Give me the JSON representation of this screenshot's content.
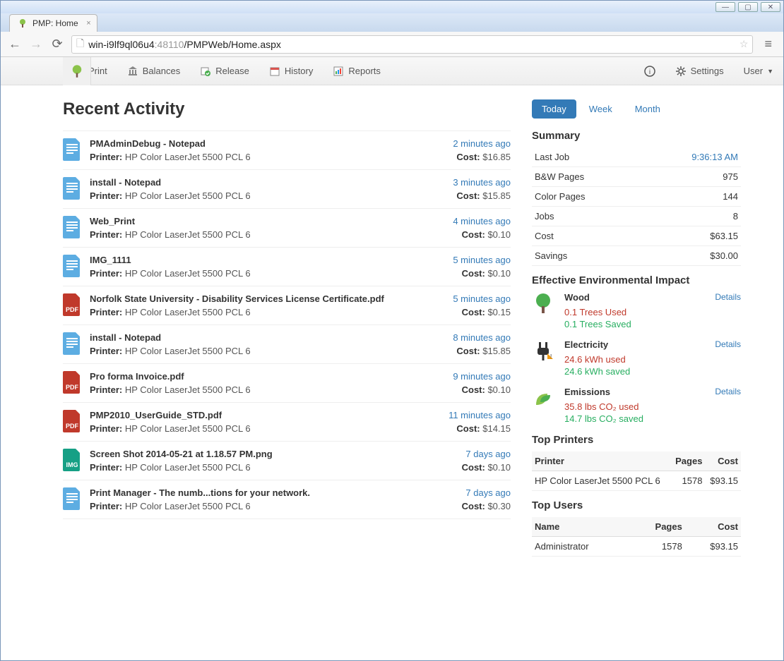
{
  "window": {
    "tab_title": "PMP: Home",
    "url_host": "win-i9lf9ql06u4",
    "url_port": ":48110",
    "url_path": "/PMPWeb/Home.aspx"
  },
  "nav": {
    "print": "Print",
    "balances": "Balances",
    "release": "Release",
    "history": "History",
    "reports": "Reports",
    "settings": "Settings",
    "user": "User"
  },
  "page_title": "Recent Activity",
  "activities": [
    {
      "title": "PMAdminDebug - Notepad",
      "printer": "HP Color LaserJet 5500 PCL 6",
      "time": "2 minutes ago",
      "cost": "$16.85",
      "type": "doc"
    },
    {
      "title": "install - Notepad",
      "printer": "HP Color LaserJet 5500 PCL 6",
      "time": "3 minutes ago",
      "cost": "$15.85",
      "type": "doc"
    },
    {
      "title": "Web_Print",
      "printer": "HP Color LaserJet 5500 PCL 6",
      "time": "4 minutes ago",
      "cost": "$0.10",
      "type": "doc"
    },
    {
      "title": "IMG_1111",
      "printer": "HP Color LaserJet 5500 PCL 6",
      "time": "5 minutes ago",
      "cost": "$0.10",
      "type": "doc"
    },
    {
      "title": "Norfolk State University - Disability Services License Certificate.pdf",
      "printer": "HP Color LaserJet 5500 PCL 6",
      "time": "5 minutes ago",
      "cost": "$0.15",
      "type": "pdf"
    },
    {
      "title": "install - Notepad",
      "printer": "HP Color LaserJet 5500 PCL 6",
      "time": "8 minutes ago",
      "cost": "$15.85",
      "type": "doc"
    },
    {
      "title": "Pro forma Invoice.pdf",
      "printer": "HP Color LaserJet 5500 PCL 6",
      "time": "9 minutes ago",
      "cost": "$0.10",
      "type": "pdf"
    },
    {
      "title": "PMP2010_UserGuide_STD.pdf",
      "printer": "HP Color LaserJet 5500 PCL 6",
      "time": "11 minutes ago",
      "cost": "$14.15",
      "type": "pdf"
    },
    {
      "title": "Screen Shot 2014-05-21 at 1.18.57 PM.png",
      "printer": "HP Color LaserJet 5500 PCL 6",
      "time": "7 days ago",
      "cost": "$0.10",
      "type": "img"
    },
    {
      "title": "Print Manager - The numb...tions for your network.",
      "printer": "HP Color LaserJet 5500 PCL 6",
      "time": "7 days ago",
      "cost": "$0.30",
      "type": "doc"
    }
  ],
  "labels": {
    "printer": "Printer:",
    "cost": "Cost:"
  },
  "period_tabs": {
    "today": "Today",
    "week": "Week",
    "month": "Month"
  },
  "summary": {
    "heading": "Summary",
    "rows": [
      {
        "k": "Last Job",
        "v": "9:36:13 AM",
        "link": true
      },
      {
        "k": "B&W Pages",
        "v": "975"
      },
      {
        "k": "Color Pages",
        "v": "144"
      },
      {
        "k": "Jobs",
        "v": "8"
      },
      {
        "k": "Cost",
        "v": "$63.15"
      },
      {
        "k": "Savings",
        "v": "$30.00"
      }
    ]
  },
  "env": {
    "heading": "Effective Environmental Impact",
    "details": "Details",
    "items": [
      {
        "name": "Wood",
        "used": "0.1 Trees Used",
        "saved": "0.1 Trees Saved",
        "icon": "tree"
      },
      {
        "name": "Electricity",
        "used": "24.6 kWh used",
        "saved": "24.6 kWh saved",
        "icon": "plug"
      },
      {
        "name": "Emissions",
        "used": "35.8 lbs CO₂ used",
        "saved": "14.7 lbs CO₂ saved",
        "icon": "leaf"
      }
    ]
  },
  "top_printers": {
    "heading": "Top Printers",
    "cols": [
      "Printer",
      "Pages",
      "Cost"
    ],
    "rows": [
      [
        "HP Color LaserJet 5500 PCL 6",
        "1578",
        "$93.15"
      ]
    ]
  },
  "top_users": {
    "heading": "Top Users",
    "cols": [
      "Name",
      "Pages",
      "Cost"
    ],
    "rows": [
      [
        "Administrator",
        "1578",
        "$93.15"
      ]
    ]
  }
}
